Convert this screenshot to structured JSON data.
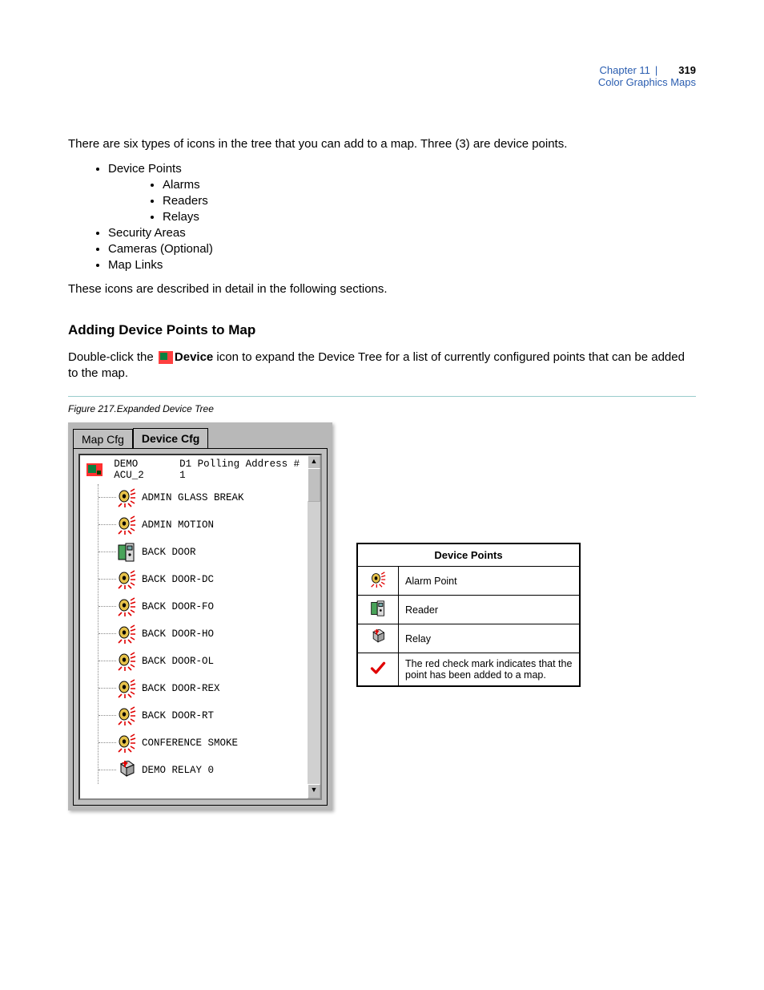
{
  "header": {
    "chapter": "Chapter 11",
    "subtitle": "Color Graphics Maps",
    "page_number": "319"
  },
  "intro_para": "There are six types of icons in the tree that you can add to a map. Three (3) are device points.",
  "icon_types": {
    "top": [
      "Device Points",
      "Security Areas",
      "Cameras (Optional)",
      "Map Links"
    ],
    "device_point_children": [
      "Alarms",
      "Readers",
      "Relays"
    ]
  },
  "transition_para": "These icons are described in detail in the following sections.",
  "section_heading": "Adding Device Points to Map",
  "instruction_pre": "Double-click the ",
  "instruction_icon_word": "Device",
  "instruction_post": " icon to expand the Device Tree for a list of currently configured points that can be added to the map.",
  "figure_caption": "Figure 217.Expanded Device Tree",
  "panel": {
    "tabs": {
      "inactive": "Map Cfg",
      "active": "Device Cfg"
    },
    "root": {
      "label": "DEMO ACU_2",
      "detail": "D1 Polling Address # 1",
      "icon": "device-icon"
    },
    "nodes": [
      {
        "icon": "alarm-icon",
        "label": "ADMIN GLASS BREAK"
      },
      {
        "icon": "alarm-icon",
        "label": "ADMIN MOTION"
      },
      {
        "icon": "reader-icon",
        "label": "BACK DOOR"
      },
      {
        "icon": "alarm-icon",
        "label": "BACK DOOR-DC"
      },
      {
        "icon": "alarm-icon",
        "label": "BACK DOOR-FO"
      },
      {
        "icon": "alarm-icon",
        "label": "BACK DOOR-HO"
      },
      {
        "icon": "alarm-icon",
        "label": "BACK DOOR-OL"
      },
      {
        "icon": "alarm-icon",
        "label": "BACK DOOR-REX"
      },
      {
        "icon": "alarm-icon",
        "label": "BACK DOOR-RT"
      },
      {
        "icon": "alarm-icon",
        "label": "CONFERENCE SMOKE"
      },
      {
        "icon": "relay-icon",
        "label": "DEMO RELAY 0"
      }
    ]
  },
  "legend": {
    "title": "Device Points",
    "rows": [
      {
        "icon": "alarm-icon",
        "text": "Alarm Point"
      },
      {
        "icon": "reader-icon",
        "text": "Reader"
      },
      {
        "icon": "relay-icon",
        "text": "Relay"
      },
      {
        "icon": "check-icon",
        "text": "The red check mark indicates that the point has been added to a map."
      }
    ]
  }
}
